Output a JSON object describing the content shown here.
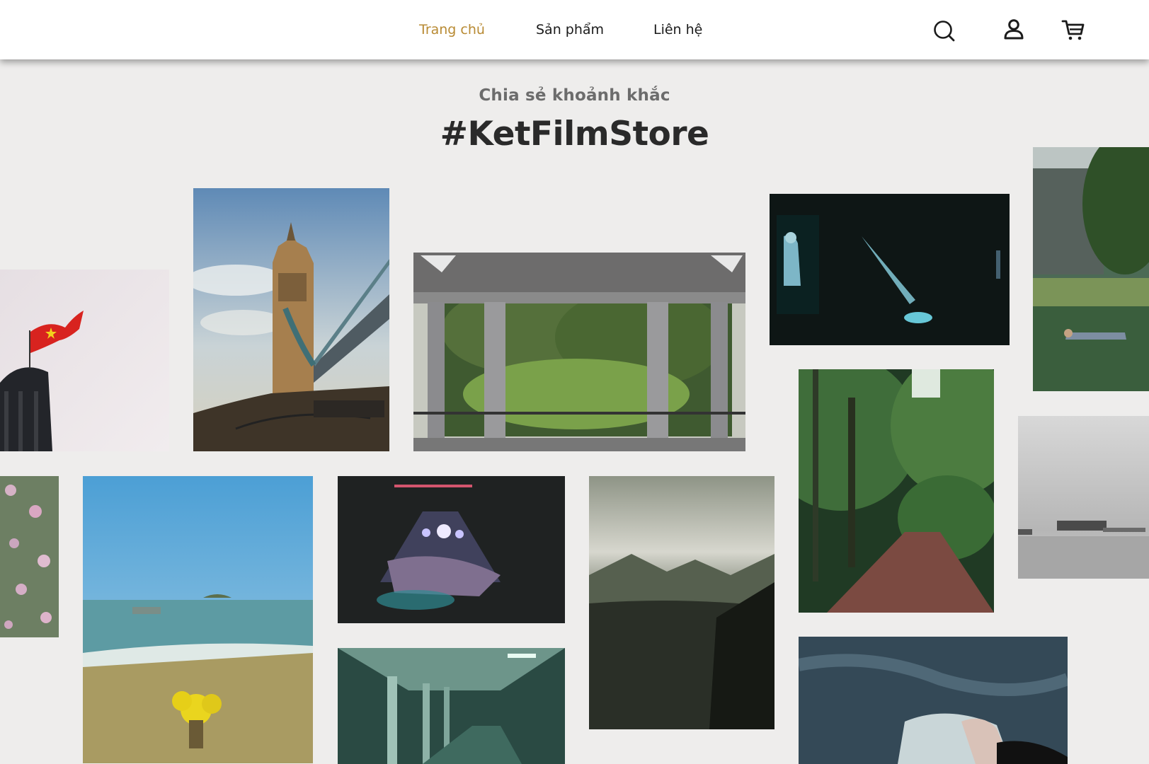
{
  "nav": {
    "items": [
      {
        "label": "Trang chủ",
        "active": true
      },
      {
        "label": "Sản phẩm",
        "active": false
      },
      {
        "label": "Liên hệ",
        "active": false
      }
    ],
    "active_color": "#b88a33",
    "icons": [
      "search-icon",
      "user-icon",
      "cart-icon"
    ]
  },
  "hero": {
    "subtitle": "Chia sẻ khoảnh khắc",
    "hashtag": "#KetFilmStore"
  },
  "gallery": {
    "photos": [
      "vietnam-flag-tower",
      "tower-bridge",
      "colonnade-park",
      "concert-spotlight",
      "park-lawn",
      "forest-path",
      "bw-river-boat",
      "wildflowers",
      "beach-yellow-flowers",
      "concert-stage",
      "mountain-valley",
      "green-tunnel",
      "water-legs"
    ]
  }
}
